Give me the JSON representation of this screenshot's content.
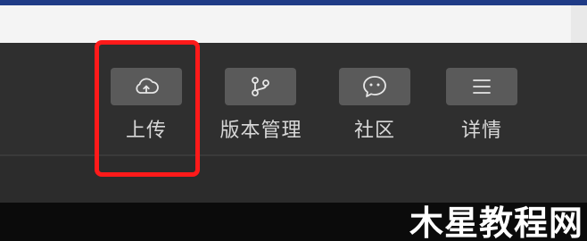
{
  "toolbar": {
    "items": [
      {
        "label": "上传",
        "icon": "cloud-upload-icon"
      },
      {
        "label": "版本管理",
        "icon": "branch-icon"
      },
      {
        "label": "社区",
        "icon": "chat-bubble-icon"
      },
      {
        "label": "详情",
        "icon": "menu-icon"
      }
    ]
  },
  "watermark": {
    "text": "木星教程网"
  },
  "colors": {
    "toolbar_bg": "#2f2f2f",
    "button_bg": "#5a5a5a",
    "label_text": "#d8d8d8",
    "highlight": "#ff1a1a",
    "top_strip": "#1f3b86"
  }
}
